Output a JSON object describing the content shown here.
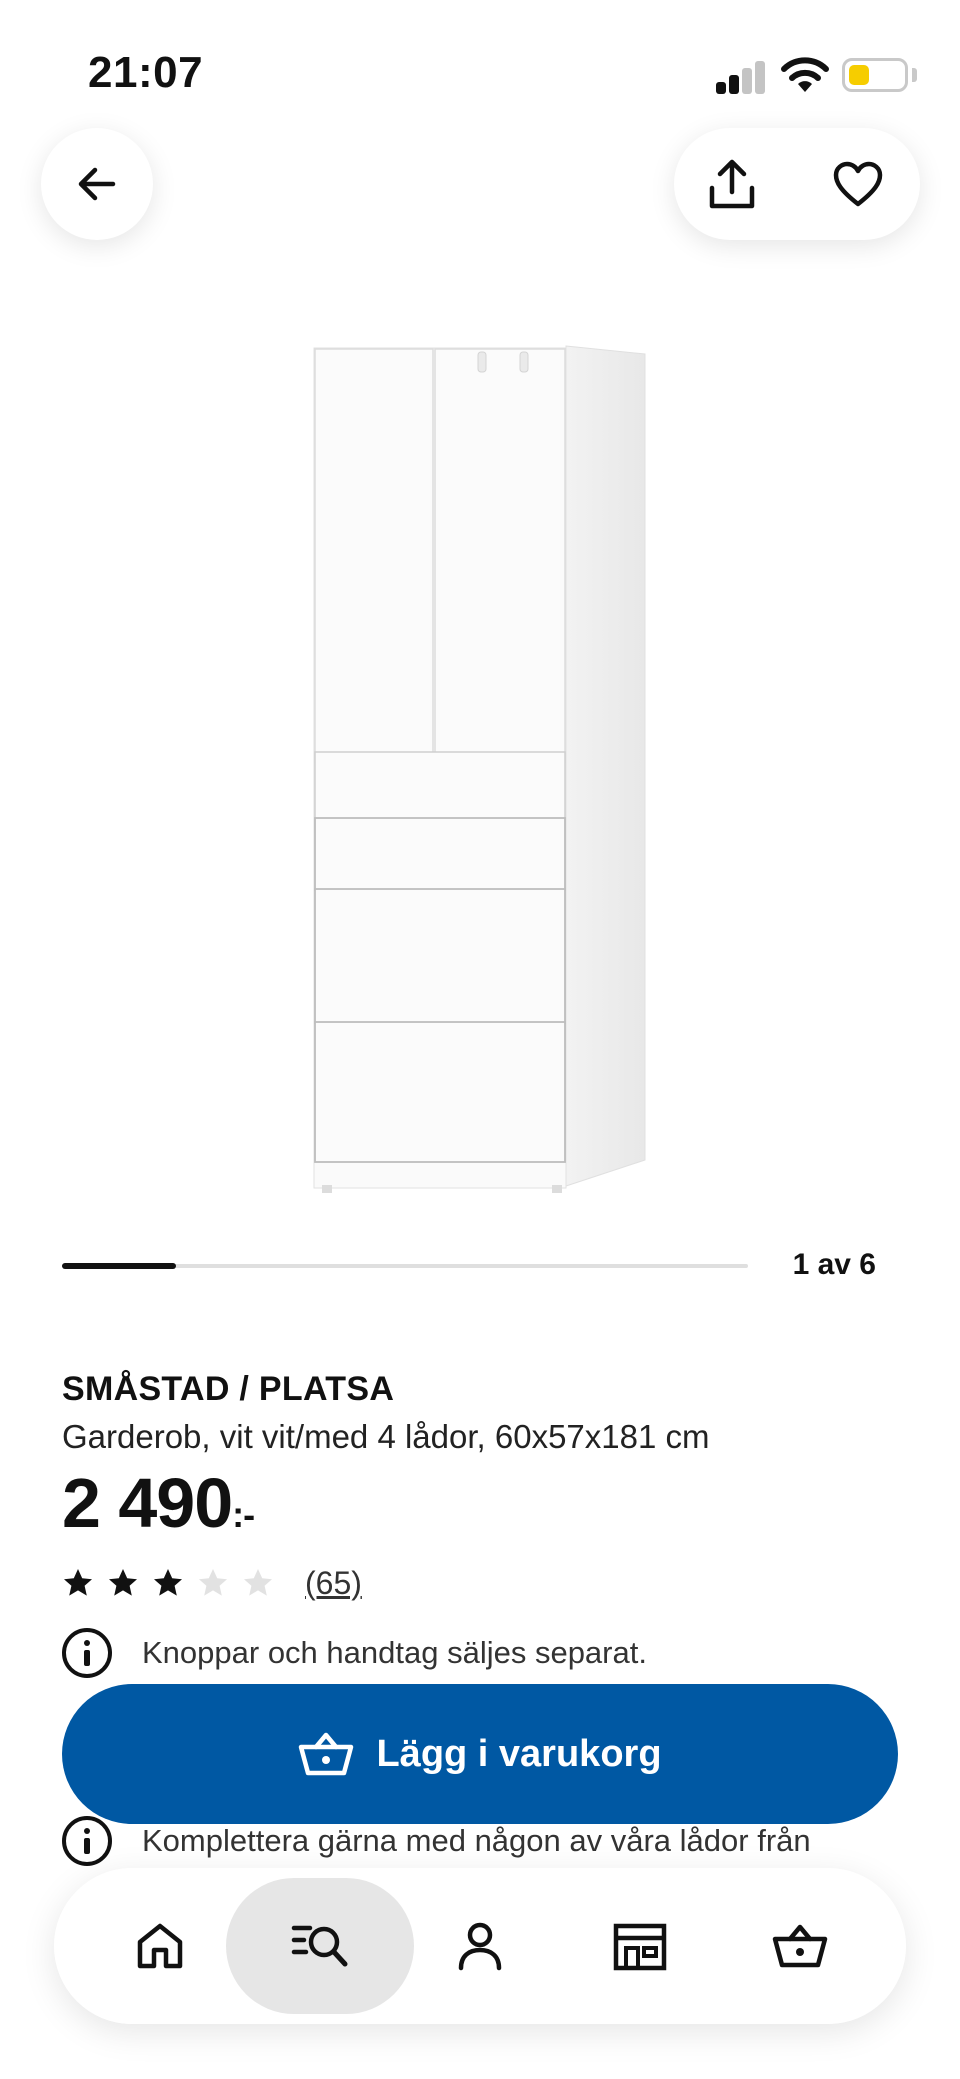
{
  "status_bar": {
    "time": "21:07",
    "icons": [
      "cellular-signal-icon",
      "wifi-icon",
      "battery-icon"
    ],
    "battery_color": "#f6cd00"
  },
  "nav": {
    "back_icon": "arrow-left-icon",
    "share_icon": "share-icon",
    "favorite_icon": "heart-icon"
  },
  "gallery": {
    "counter": "1 av 6",
    "current": 1,
    "total": 6,
    "image_icon": "wardrobe-image"
  },
  "product": {
    "name": "SMÅSTAD / PLATSA",
    "description": "Garderob, vit vit/med 4 lådor, 60x57x181 cm",
    "price": "2 490",
    "price_suffix": ":-",
    "rating": 3,
    "rating_max": 5,
    "reviews": "(65)"
  },
  "notices": [
    {
      "icon": "info-icon",
      "text": "Knoppar och handtag säljes separat."
    },
    {
      "icon": "info-icon",
      "text": "Komplettera gärna med någon av våra lådor från"
    }
  ],
  "cart_button": {
    "label": "Lägg i varukorg",
    "icon": "basket-icon",
    "color": "#0058a3"
  },
  "bottom_nav": {
    "items": [
      {
        "name": "home",
        "icon": "home-icon"
      },
      {
        "name": "search",
        "icon": "search-list-icon",
        "active": true
      },
      {
        "name": "profile",
        "icon": "person-icon"
      },
      {
        "name": "store",
        "icon": "store-icon"
      },
      {
        "name": "cart",
        "icon": "basket-icon"
      }
    ]
  }
}
